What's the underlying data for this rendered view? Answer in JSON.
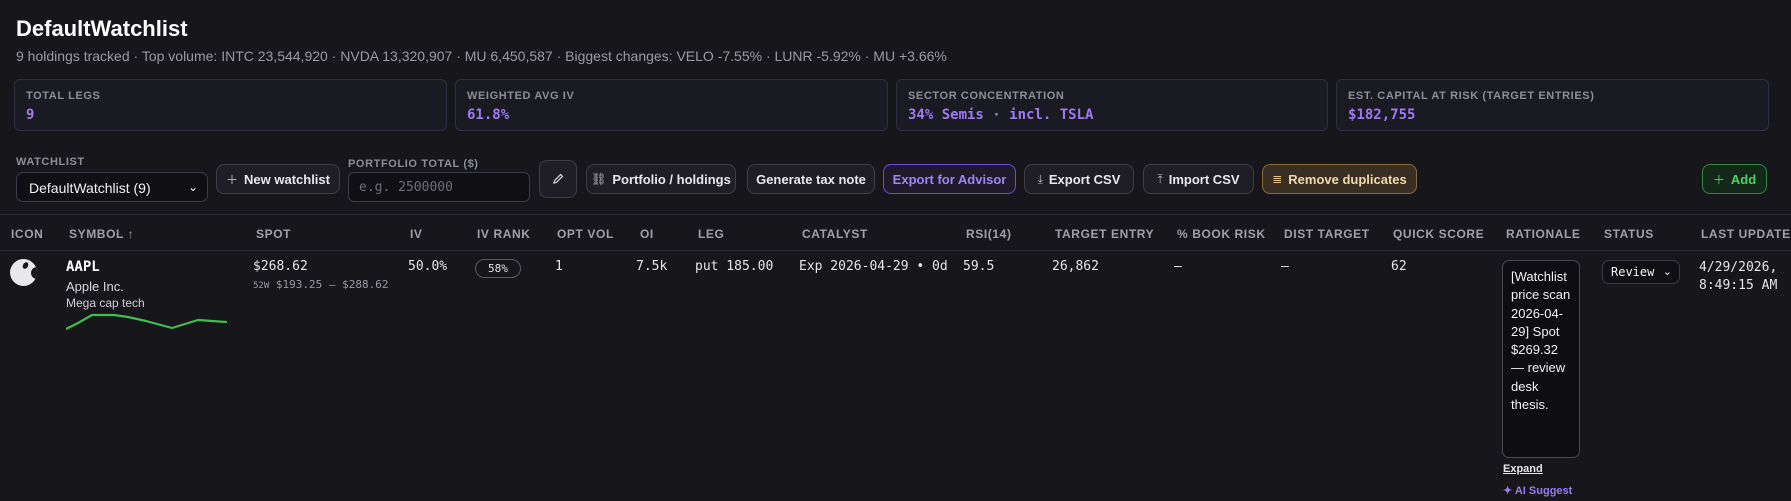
{
  "header": {
    "title": "DefaultWatchlist",
    "subtitle": "9 holdings tracked · Top volume: INTC 23,544,920 · NVDA 13,320,907 · MU 6,450,587 · Biggest changes: VELO -7.55% · LUNR -5.92% · MU +3.66%"
  },
  "kpis": [
    {
      "label": "TOTAL LEGS",
      "value": "9"
    },
    {
      "label": "WEIGHTED AVG IV",
      "value": "61.8%"
    },
    {
      "label": "SECTOR CONCENTRATION",
      "value": "34% Semis · incl. TSLA"
    },
    {
      "label": "EST. CAPITAL AT RISK (TARGET ENTRIES)",
      "value": "$182,755"
    }
  ],
  "toolbar": {
    "watchlist_label": "WATCHLIST",
    "watchlist_value": "DefaultWatchlist (9)",
    "new_watchlist": "New watchlist",
    "portfolio_total_label": "PORTFOLIO TOTAL ($)",
    "portfolio_total_placeholder": "e.g. 2500000",
    "portfolio_holdings": "Portfolio / holdings",
    "generate_tax_note": "Generate tax note",
    "export_advisor": "Export for Advisor",
    "export_csv": "Export CSV",
    "import_csv": "Import CSV",
    "remove_duplicates": "Remove duplicates",
    "add": "Add"
  },
  "table": {
    "columns": [
      "ICON",
      "SYMBOL ↑",
      "SPOT",
      "IV",
      "IV RANK",
      "OPT VOL",
      "OI",
      "LEG",
      "CATALYST",
      "RSI(14)",
      "TARGET ENTRY",
      "% BOOK RISK",
      "DIST TARGET",
      "QUICK SCORE",
      "RATIONALE",
      "STATUS",
      "LAST UPDATE"
    ],
    "rows": [
      {
        "symbol": "AAPL",
        "company": "Apple Inc.",
        "sector": "Mega cap tech",
        "spot": "$268.62",
        "range_tag": "52W",
        "range": "$193.25 — $288.62",
        "iv": "50.0%",
        "iv_rank": "58%",
        "opt_vol": "1",
        "oi": "7.5k",
        "leg": "put 185.00",
        "catalyst": "Exp 2026-04-29 • 0d",
        "rsi": "59.5",
        "target_entry": "26,862",
        "book_risk": "—",
        "dist_target": "—",
        "quick_score": "62",
        "rationale": "[Watchlist price scan 2026-04-29] Spot $269.32 — review desk thesis.",
        "expand": "Expand",
        "ai_suggest": "✦ AI Suggest",
        "status": "Review",
        "last_update_date": "4/29/2026,",
        "last_update_time": "8:49:15 AM"
      }
    ]
  },
  "colors": {
    "background": "#16161b",
    "accent_purple": "#a078f2",
    "accent_green": "#4ed364",
    "sparkline": "#3fbf4f"
  },
  "icons": [
    "plus-icon",
    "pencil-icon",
    "link-icon",
    "download-icon",
    "upload-icon",
    "dedupe-icon",
    "chevron-down-icon",
    "apple-logo-icon"
  ]
}
